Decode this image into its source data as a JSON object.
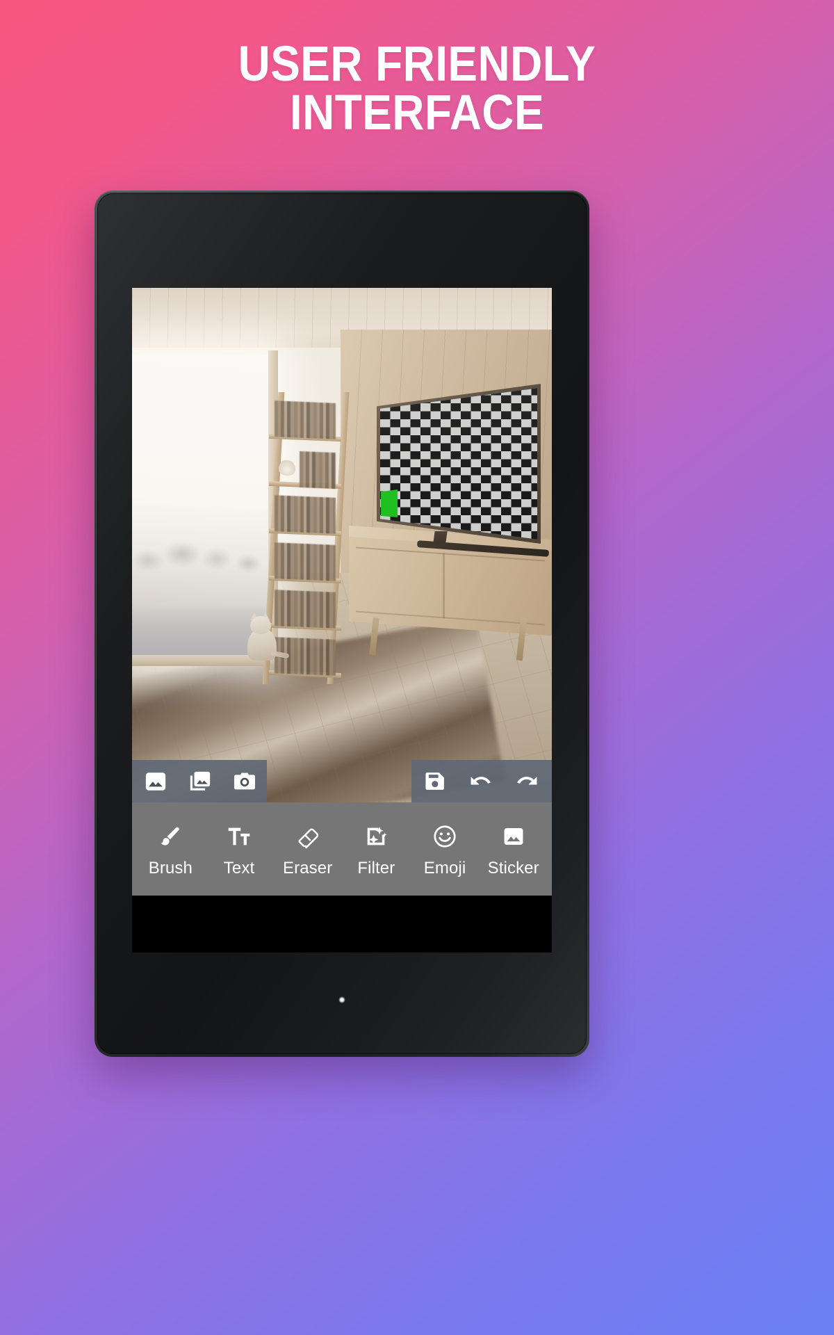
{
  "headline": {
    "line1": "USER FRIENDLY",
    "line2": "INTERFACE"
  },
  "colors": {
    "bg_start": "#F9577F",
    "bg_end": "#6B80F5",
    "toolbar_overlay": "#606874",
    "tool_strip": "#767676",
    "icon_white": "#FFFFFF",
    "tv_green_patch": "#20C020"
  },
  "device": {
    "type": "tablet",
    "camera": "front-camera-dot",
    "led": "status-led-dot"
  },
  "app": {
    "canvas": {
      "description": "photo of a wood-panelled room with bright window, ladder bookshelf, cat, TV on sideboard showing checkerboard test pattern with a green square"
    },
    "top_toolbar": {
      "left_actions": [
        {
          "id": "gallery-single",
          "icon": "image-icon",
          "label": "Gallery"
        },
        {
          "id": "gallery-multi",
          "icon": "images-stack-icon",
          "label": "Collage"
        },
        {
          "id": "camera",
          "icon": "camera-icon",
          "label": "Camera"
        }
      ],
      "right_actions": [
        {
          "id": "save",
          "icon": "save-floppy-icon",
          "label": "Save"
        },
        {
          "id": "undo",
          "icon": "undo-arrow-icon",
          "label": "Undo"
        },
        {
          "id": "redo",
          "icon": "redo-arrow-icon",
          "label": "Redo"
        }
      ]
    },
    "tools": [
      {
        "id": "brush",
        "label": "Brush",
        "icon": "brush-icon"
      },
      {
        "id": "text",
        "label": "Text",
        "icon": "text-tt-icon"
      },
      {
        "id": "eraser",
        "label": "Eraser",
        "icon": "eraser-icon"
      },
      {
        "id": "filter",
        "label": "Filter",
        "icon": "filter-sparkle-icon"
      },
      {
        "id": "emoji",
        "label": "Emoji",
        "icon": "smiley-icon"
      },
      {
        "id": "sticker",
        "label": "Sticker",
        "icon": "sticker-image-icon"
      }
    ]
  }
}
